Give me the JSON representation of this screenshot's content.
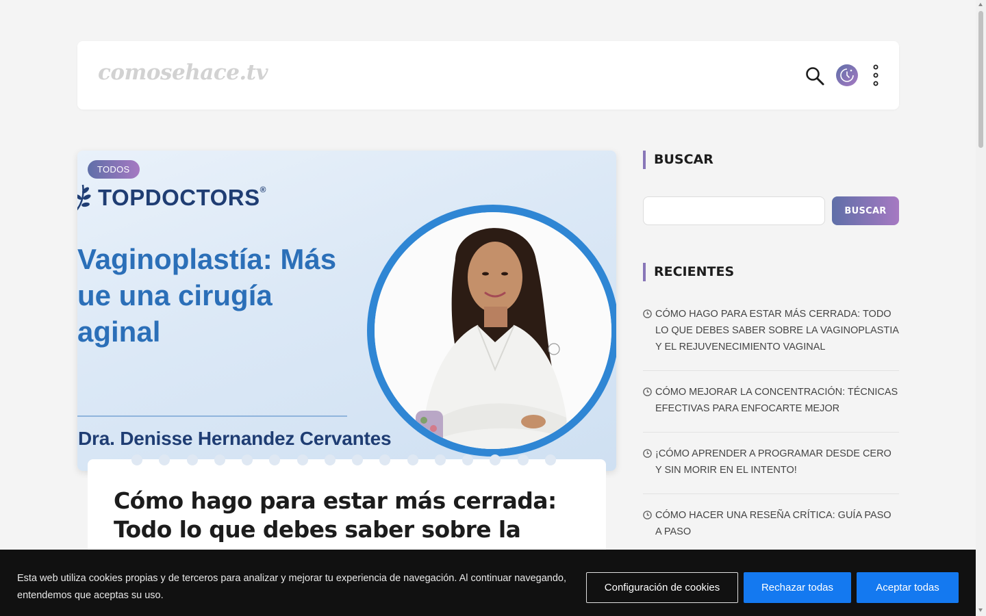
{
  "header": {
    "logo": "comosehace.tv",
    "search_icon": "search-icon",
    "mode_icon": "moon-clock-icon",
    "menu_icon": "vertical-dots-icon"
  },
  "featured": {
    "badge": "TODOS",
    "image": {
      "brand": "TOPDOCTORS",
      "brand_mark": "®",
      "headline": "Vaginoplastía: Más\nue una cirugía\naginal",
      "doctor_name": "Dra. Denisse Hernandez Cervantes"
    },
    "title": "Cómo hago para estar más cerrada: Todo lo que debes saber sobre la"
  },
  "sidebar": {
    "search_heading": "BUSCAR",
    "search_input_value": "",
    "search_button": "BUSCAR",
    "recent_heading": "RECIENTES",
    "recent": [
      "CÓMO HAGO PARA ESTAR MÁS CERRADA: TODO LO QUE DEBES SABER SOBRE LA VAGINOPLASTIA Y EL REJUVENECIMIENTO VAGINAL",
      "CÓMO MEJORAR LA CONCENTRACIÓN: TÉCNICAS EFECTIVAS PARA ENFOCARTE MEJOR",
      "¡CÓMO APRENDER A PROGRAMAR DESDE CERO Y SIN MORIR EN EL INTENTO!",
      "CÓMO HACER UNA RESEÑA CRÍTICA: GUÍA PASO A PASO"
    ]
  },
  "cookie_banner": {
    "text": "Esta web utiliza cookies propias y de terceros para analizar y mejorar tu experiencia de navegación. Al continuar navegando, entendemos que aceptas su uso.",
    "config_button": "Configuración de cookies",
    "reject_button": "Rechazar todas",
    "accept_button": "Aceptar todas"
  },
  "colors": {
    "accent_gradient_start": "#5f6fa8",
    "accent_gradient_end": "#a679c2",
    "cookie_button_blue": "#1479f0",
    "image_blue": "#2b6fb8"
  }
}
